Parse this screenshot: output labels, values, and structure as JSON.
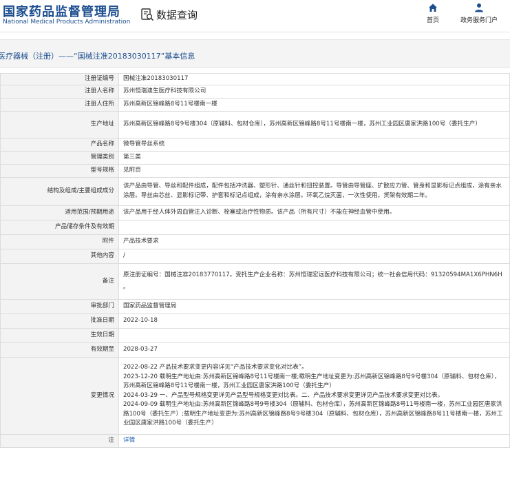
{
  "header": {
    "logo_cn": "国家药品监督管理局",
    "logo_en": "National Medical Products Administration",
    "query_label": "数据查询",
    "nav": {
      "home": "首页",
      "gov_service": "政务服务门户"
    }
  },
  "breadcrumb_title": "医疗器械（注册）——“国械注准20183030117”基本信息",
  "colors": {
    "brand": "#1d4e8f",
    "link": "#1d5fb0",
    "label_bg": "#f3f3f3",
    "border": "#dcdcdc"
  },
  "rows": [
    {
      "label": "注册证编号",
      "value": "国械注准20183030117"
    },
    {
      "label": "注册人名称",
      "value": "苏州恒瑞迪生医疗科技有限公司"
    },
    {
      "label": "注册人住所",
      "value": "苏州高新区锦峰路8号11号楼南一楼"
    },
    {
      "label": "生产地址",
      "value": "苏州高新区锦峰路8号9号楼304（原辅料、包材仓库），苏州高新区锦峰路8号11号楼南一楼，苏州工业园区唐家洪路100号（委托生产）"
    },
    {
      "label": "产品名称",
      "value": "微导管导丝系统"
    },
    {
      "label": "管理类别",
      "value": "第三类"
    },
    {
      "label": "型号规格",
      "value": "见附页"
    },
    {
      "label": "结构及组成/主要组成成分",
      "value": "该产品由导管、导丝和配件组成，配件包括冲洗器、塑形针、通丝针和扭控装置。导管由导管座、扩散应力管、管身和显影标记点组成，涂有亲水涂层。导丝由芯丝、显影标记带、护套和标记点组成，涂有亲水涂层。环氧乙烷灭菌，一次性使用。货架有效期二年。"
    },
    {
      "label": "适用范围/预期用途",
      "value": "该产品用于经人体外周血管注入诊断、栓塞或治疗性物质。该产品（所有尺寸）不能在神经血管中使用。"
    },
    {
      "label": "产品储存条件及有效期",
      "value": ""
    },
    {
      "label": "附件",
      "value": "产品技术要求"
    },
    {
      "label": "其他内容",
      "value": "/"
    },
    {
      "label": "备注",
      "value": "原注册证编号：国械注准20183770117。受托生产企业名称：苏州恒瑞宏远医疗科技有限公司；统一社会信用代码：91320594MA1X6PHN6H",
      "extra": "。"
    },
    {
      "label": "审批部门",
      "value": "国家药品监督管理局"
    },
    {
      "label": "批准日期",
      "value": "2022-10-18"
    },
    {
      "label": "生效日期",
      "value": ""
    },
    {
      "label": "有效期至",
      "value": "2028-03-27"
    },
    {
      "label": "变更情况",
      "lines": [
        "2022-08-22 产品技术要求变更内容详见“产品技术要求变化对比表”。",
        "2023-12-20 载明生产地址由:苏州高新区锦峰路8号11号楼南一楼;载明生产地址变更为:苏州高新区锦峰路8号9号楼304（原辅料、包材仓库），苏州高新区锦峰路8号11号楼南一楼，苏州工业园区唐家洪路100号（委托生产）",
        "2024-03-29 一、产品型号规格变更详见产品型号规格变更对比表。二、产品技术要求变更详见产品技术要求变更对比表。",
        "2024-09-09 载明生产地址由:苏州高新区锦峰路8号9号楼304（原辅料、包材仓库），苏州高新区锦峰路8号11号楼南一楼，苏州工业园区唐家洪路100号（委托生产）;载明生产地址变更为:苏州高新区锦峰路8号9号楼304（原辅料、包材仓库），苏州高新区锦峰路8号11号楼南一楼，苏州工业园区唐家洪路100号（委托生产）"
      ]
    },
    {
      "label": "注",
      "value": "详情",
      "is_link": true
    }
  ]
}
